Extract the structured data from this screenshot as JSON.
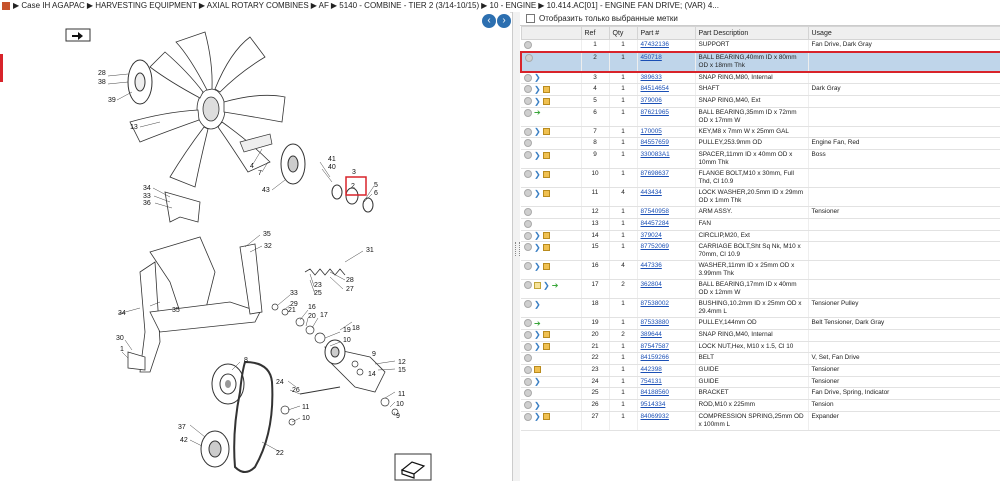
{
  "breadcrumb": [
    "Case IH AGAPAC",
    "HARVESTING EQUIPMENT",
    "AXIAL ROTARY COMBINES",
    "AF",
    "5140 - COMBINE - TIER 2 (3/14-10/15)",
    "10 - ENGINE",
    "10.414.AC[01] - ENGINE FAN DRIVE; (VAR) 4..."
  ],
  "filter_label": "Отобразить только выбранные метки",
  "columns": [
    "Ref",
    "Qty",
    "Part #",
    "Part Description",
    "Usage"
  ],
  "selected_ref": "2",
  "diagram": {
    "callouts": [
      "28",
      "38",
      "39",
      "13",
      "4",
      "7",
      "41",
      "40",
      "43",
      "2",
      "3",
      "5",
      "6",
      "34",
      "33",
      "36",
      "35",
      "32",
      "31",
      "28",
      "27",
      "23",
      "29",
      "21",
      "16",
      "20",
      "17",
      "19",
      "10",
      "18",
      "9",
      "14",
      "8",
      "24",
      "26",
      "11",
      "12",
      "37",
      "42",
      "15",
      "22",
      "30",
      "1",
      "25"
    ],
    "highlighted_callout": "2"
  },
  "parts": [
    {
      "ref": "1",
      "qty": "1",
      "part": "47432136",
      "desc": "SUPPORT",
      "usage": "Fan Drive, Dark Gray",
      "icons": []
    },
    {
      "ref": "2",
      "qty": "1",
      "part": "450718",
      "desc": "BALL BEARING,40mm ID x 80mm OD x 18mm Thk",
      "usage": "",
      "icons": []
    },
    {
      "ref": "3",
      "qty": "1",
      "part": "389633",
      "desc": "SNAP RING,M80, Internal",
      "usage": "",
      "icons": [
        "blue"
      ]
    },
    {
      "ref": "4",
      "qty": "1",
      "part": "84514654",
      "desc": "SHAFT",
      "usage": "Dark Gray",
      "icons": [
        "blue",
        "box"
      ]
    },
    {
      "ref": "5",
      "qty": "1",
      "part": "379006",
      "desc": "SNAP RING,M40, Ext",
      "usage": "",
      "icons": [
        "blue",
        "box"
      ]
    },
    {
      "ref": "6",
      "qty": "1",
      "part": "87621965",
      "desc": "BALL BEARING,35mm ID x 72mm OD x 17mm W",
      "usage": "",
      "icons": [
        "green"
      ]
    },
    {
      "ref": "7",
      "qty": "1",
      "part": "170005",
      "desc": "KEY,M8 x 7mm W x 25mm GAL",
      "usage": "",
      "icons": [
        "blue",
        "box"
      ]
    },
    {
      "ref": "8",
      "qty": "1",
      "part": "84557659",
      "desc": "PULLEY,253.9mm OD",
      "usage": "Engine Fan, Red",
      "icons": []
    },
    {
      "ref": "9",
      "qty": "1",
      "part": "330083A1",
      "desc": "SPACER,11mm ID x 40mm OD x 10mm Thk",
      "usage": "Boss",
      "icons": [
        "blue",
        "box"
      ]
    },
    {
      "ref": "10",
      "qty": "1",
      "part": "87698637",
      "desc": "FLANGE BOLT,M10 x 30mm, Full Thd, Cl 10.9",
      "usage": "",
      "icons": [
        "blue",
        "box"
      ]
    },
    {
      "ref": "11",
      "qty": "4",
      "part": "443434",
      "desc": "LOCK WASHER,20.5mm ID x 29mm OD x 1mm Thk",
      "usage": "",
      "icons": [
        "blue",
        "box"
      ]
    },
    {
      "ref": "12",
      "qty": "1",
      "part": "87540958",
      "desc": "ARM ASSY.",
      "usage": "Tensioner",
      "icons": []
    },
    {
      "ref": "13",
      "qty": "1",
      "part": "84457284",
      "desc": "FAN",
      "usage": "",
      "icons": []
    },
    {
      "ref": "14",
      "qty": "1",
      "part": "379024",
      "desc": "CIRCLIP,M20, Ext",
      "usage": "",
      "icons": [
        "blue",
        "box"
      ]
    },
    {
      "ref": "15",
      "qty": "1",
      "part": "87752069",
      "desc": "CARRIAGE BOLT,Sht Sq Nk, M10 x 70mm, Cl 10.9",
      "usage": "",
      "icons": [
        "blue",
        "box"
      ]
    },
    {
      "ref": "16",
      "qty": "4",
      "part": "447336",
      "desc": "WASHER,11mm ID x 25mm OD x 3.99mm Thk",
      "usage": "",
      "icons": [
        "blue",
        "box"
      ]
    },
    {
      "ref": "17",
      "qty": "2",
      "part": "362804",
      "desc": "BALL BEARING,17mm ID x 40mm OD x 12mm W",
      "usage": "",
      "icons": [
        "note",
        "blue",
        "green"
      ]
    },
    {
      "ref": "18",
      "qty": "1",
      "part": "87538002",
      "desc": "BUSHING,10.2mm ID x 25mm OD x 29.4mm L",
      "usage": "Tensioner Pulley",
      "icons": [
        "blue"
      ]
    },
    {
      "ref": "19",
      "qty": "1",
      "part": "87533880",
      "desc": "PULLEY,144mm OD",
      "usage": "Belt Tensioner, Dark Gray",
      "icons": [
        "green"
      ]
    },
    {
      "ref": "20",
      "qty": "2",
      "part": "389644",
      "desc": "SNAP RING,M40, Internal",
      "usage": "",
      "icons": [
        "blue",
        "box"
      ]
    },
    {
      "ref": "21",
      "qty": "1",
      "part": "87547587",
      "desc": "LOCK NUT,Hex, M10 x 1.5, Cl 10",
      "usage": "",
      "icons": [
        "blue",
        "box"
      ]
    },
    {
      "ref": "22",
      "qty": "1",
      "part": "84159266",
      "desc": "BELT",
      "usage": "V, Set, Fan Drive",
      "icons": []
    },
    {
      "ref": "23",
      "qty": "1",
      "part": "442398",
      "desc": "GUIDE",
      "usage": "Tensioner",
      "icons": [
        "box"
      ]
    },
    {
      "ref": "24",
      "qty": "1",
      "part": "754131",
      "desc": "GUIDE",
      "usage": "Tensioner",
      "icons": [
        "blue"
      ]
    },
    {
      "ref": "25",
      "qty": "1",
      "part": "84188560",
      "desc": "BRACKET",
      "usage": "Fan Drive, Spring, Indicator",
      "icons": []
    },
    {
      "ref": "26",
      "qty": "1",
      "part": "9514334",
      "desc": "ROD,M10 x 225mm",
      "usage": "Tension",
      "icons": [
        "blue"
      ]
    },
    {
      "ref": "27",
      "qty": "1",
      "part": "84069932",
      "desc": "COMPRESSION SPRING,25mm OD x 100mm L",
      "usage": "Expander",
      "icons": [
        "blue",
        "box"
      ]
    }
  ]
}
